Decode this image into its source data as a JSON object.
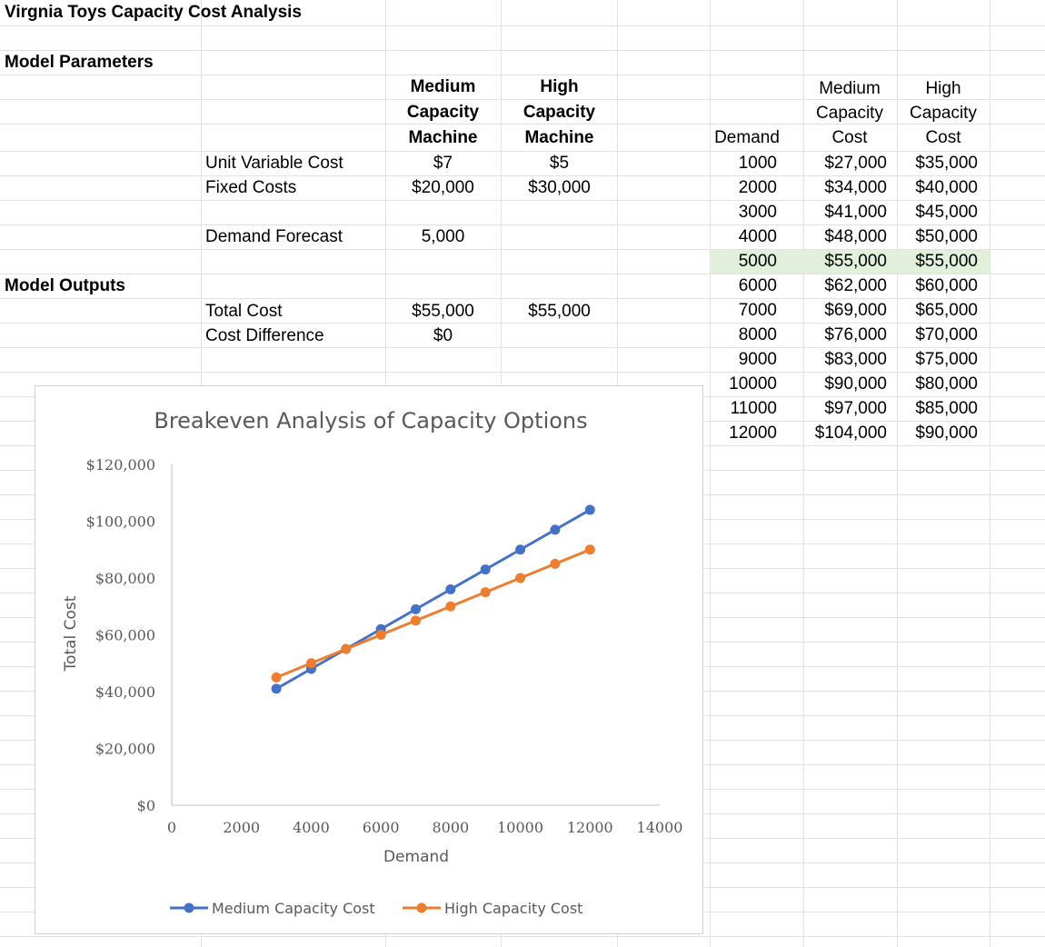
{
  "sheet": {
    "title": "Virgnia Toys Capacity Cost Analysis",
    "model_parameters_label": "Model Parameters",
    "model_outputs_label": "Model Outputs",
    "col_headers": {
      "medium": [
        "Medium",
        "Capacity",
        "Machine"
      ],
      "high": [
        "High",
        "Capacity",
        "Machine"
      ]
    },
    "params": {
      "unit_variable_cost_label": "Unit Variable Cost",
      "unit_variable_cost_medium": "$7",
      "unit_variable_cost_high": "$5",
      "fixed_costs_label": "Fixed Costs",
      "fixed_costs_medium": "$20,000",
      "fixed_costs_high": "$30,000",
      "demand_forecast_label": "Demand Forecast",
      "demand_forecast_value": "5,000"
    },
    "outputs": {
      "total_cost_label": "Total Cost",
      "total_cost_medium": "$55,000",
      "total_cost_high": "$55,000",
      "cost_difference_label": "Cost Difference",
      "cost_difference_value": "$0"
    },
    "table": {
      "headers": {
        "demand": "Demand",
        "medium": [
          "Medium",
          "Capacity",
          "Cost"
        ],
        "high": [
          "High",
          "Capacity",
          "Cost"
        ]
      },
      "rows": [
        [
          "1000",
          "$27,000",
          "$35,000"
        ],
        [
          "2000",
          "$34,000",
          "$40,000"
        ],
        [
          "3000",
          "$41,000",
          "$45,000"
        ],
        [
          "4000",
          "$48,000",
          "$50,000"
        ],
        [
          "5000",
          "$55,000",
          "$55,000"
        ],
        [
          "6000",
          "$62,000",
          "$60,000"
        ],
        [
          "7000",
          "$69,000",
          "$65,000"
        ],
        [
          "8000",
          "$76,000",
          "$70,000"
        ],
        [
          "9000",
          "$83,000",
          "$75,000"
        ],
        [
          "10000",
          "$90,000",
          "$80,000"
        ],
        [
          "11000",
          "$97,000",
          "$85,000"
        ],
        [
          "12000",
          "$104,000",
          "$90,000"
        ]
      ],
      "highlight_color": "#e2efda"
    }
  },
  "chart_data": {
    "type": "scatter",
    "title": "Breakeven Analysis of Capacity Options",
    "xlabel": "Demand",
    "ylabel": "Total Cost",
    "xlim": [
      0,
      14000
    ],
    "ylim": [
      0,
      120000
    ],
    "x_ticks": [
      0,
      2000,
      4000,
      6000,
      8000,
      10000,
      12000,
      14000
    ],
    "x_tick_labels": [
      "0",
      "2000",
      "4000",
      "6000",
      "8000",
      "10000",
      "12000",
      "14000"
    ],
    "y_ticks": [
      0,
      20000,
      40000,
      60000,
      80000,
      100000,
      120000
    ],
    "y_tick_labels": [
      "$0",
      "$20,000",
      "$40,000",
      "$60,000",
      "$80,000",
      "$100,000",
      "$120,000"
    ],
    "grid": false,
    "legend_position": "bottom",
    "x": [
      3000,
      4000,
      5000,
      6000,
      7000,
      8000,
      9000,
      10000,
      11000,
      12000
    ],
    "series": [
      {
        "name": "Medium Capacity Cost",
        "color": "#4472c4",
        "values": [
          41000,
          48000,
          55000,
          62000,
          69000,
          76000,
          83000,
          90000,
          97000,
          104000
        ]
      },
      {
        "name": "High Capacity Cost",
        "color": "#ed7d31",
        "values": [
          45000,
          50000,
          55000,
          60000,
          65000,
          70000,
          75000,
          80000,
          85000,
          90000
        ]
      }
    ]
  }
}
